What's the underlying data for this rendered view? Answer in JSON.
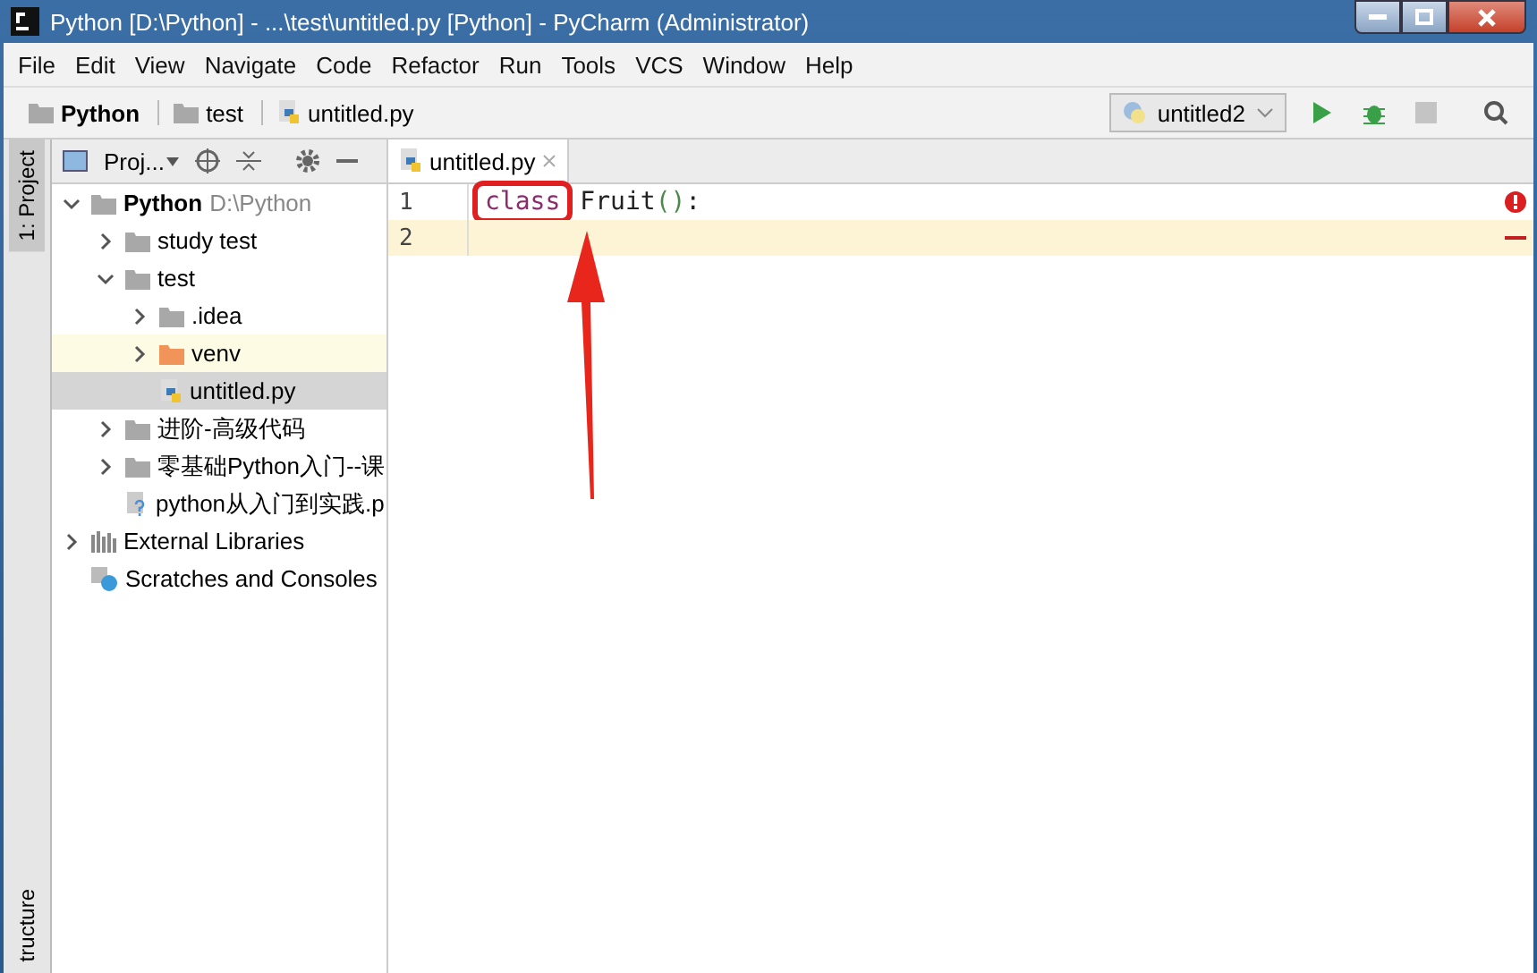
{
  "window": {
    "title": "Python [D:\\Python] - ...\\test\\untitled.py [Python] - PyCharm (Administrator)"
  },
  "menu": [
    "File",
    "Edit",
    "View",
    "Navigate",
    "Code",
    "Refactor",
    "Run",
    "Tools",
    "VCS",
    "Window",
    "Help"
  ],
  "breadcrumbs": [
    {
      "label": "Python",
      "kind": "folder"
    },
    {
      "label": "test",
      "kind": "folder"
    },
    {
      "label": "untitled.py",
      "kind": "python-file"
    }
  ],
  "run_config": "untitled2",
  "side_tabs": {
    "top": "1: Project",
    "bottom": "tructure"
  },
  "project_panel": {
    "title": "Proj...",
    "tree": [
      {
        "label": "Python",
        "path": "D:\\Python",
        "kind": "project",
        "expanded": true,
        "selected": false,
        "highlighted": false,
        "children": [
          {
            "label": "study test",
            "kind": "folder",
            "expanded": false,
            "selected": false,
            "highlighted": false
          },
          {
            "label": "test",
            "kind": "folder",
            "expanded": true,
            "selected": false,
            "highlighted": false,
            "children": [
              {
                "label": ".idea",
                "kind": "folder",
                "expanded": false,
                "selected": false,
                "highlighted": false
              },
              {
                "label": "venv",
                "kind": "excluded-folder",
                "expanded": false,
                "selected": false,
                "highlighted": true
              },
              {
                "label": "untitled.py",
                "kind": "python-file",
                "selected": true,
                "highlighted": false
              }
            ]
          },
          {
            "label": "进阶-高级代码",
            "kind": "folder",
            "expanded": false,
            "selected": false,
            "highlighted": false
          },
          {
            "label": "零基础Python入门--课",
            "kind": "folder",
            "expanded": false,
            "selected": false,
            "highlighted": false
          },
          {
            "label": "python从入门到实践.p",
            "kind": "pdf-file",
            "selected": false,
            "highlighted": false
          }
        ]
      },
      {
        "label": "External Libraries",
        "kind": "libraries",
        "expanded": false,
        "selected": false,
        "highlighted": false
      },
      {
        "label": "Scratches and Consoles",
        "kind": "scratches",
        "selected": false,
        "highlighted": false
      }
    ]
  },
  "editor": {
    "tabs": [
      {
        "label": "untitled.py",
        "selected": true
      }
    ],
    "lines": [
      {
        "number": "1",
        "current": false,
        "tokens": [
          {
            "text": "class",
            "kind": "keyword",
            "boxed": true
          },
          {
            "text": "Fruit",
            "kind": "plain",
            "boxed": false
          },
          {
            "text": "()",
            "kind": "paren",
            "boxed": false
          },
          {
            "text": ":",
            "kind": "plain",
            "boxed": false
          }
        ]
      },
      {
        "number": "2",
        "current": true
      }
    ],
    "has_error": true
  }
}
